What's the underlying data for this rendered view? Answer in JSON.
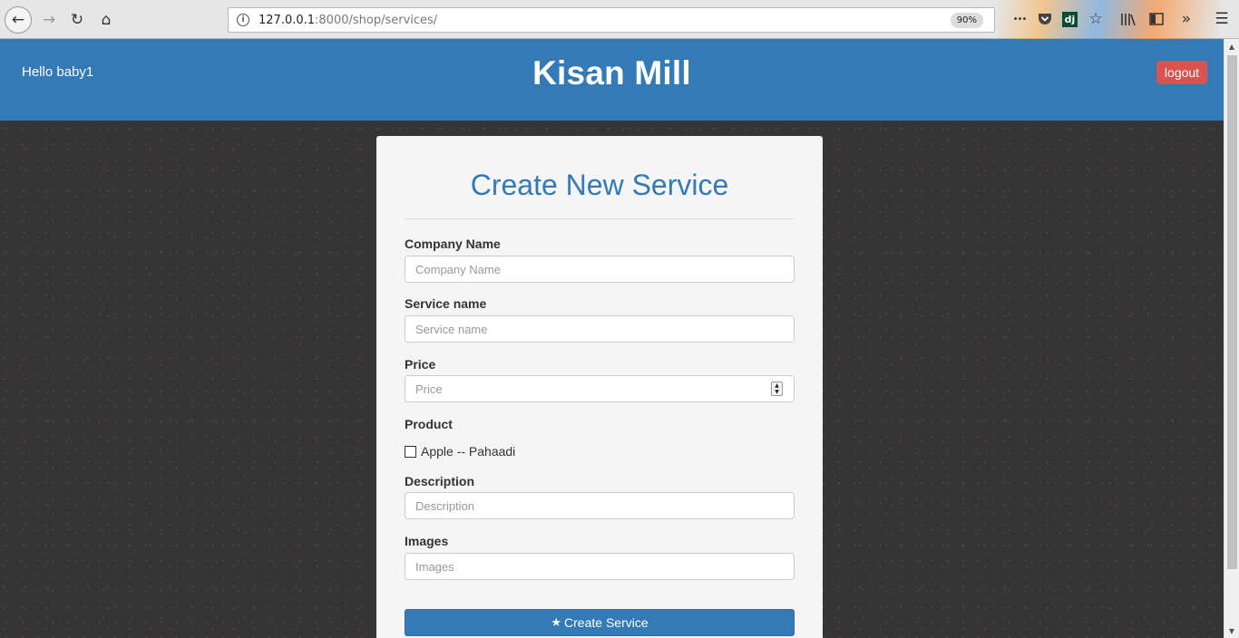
{
  "browser": {
    "url_host": "127.0.0.1",
    "url_rest": ":8000/shop/services/",
    "zoom": "90%",
    "extension_label": "dj",
    "menu_dots": "•••"
  },
  "header": {
    "greeting": "Hello baby1",
    "title": "Kisan Mill",
    "logout_label": "logout"
  },
  "form": {
    "title": "Create New Service",
    "company_name": {
      "label": "Company Name",
      "placeholder": "Company Name",
      "value": ""
    },
    "service_name": {
      "label": "Service name",
      "placeholder": "Service name",
      "value": ""
    },
    "price": {
      "label": "Price",
      "placeholder": "Price",
      "value": ""
    },
    "product": {
      "label": "Product",
      "options": [
        {
          "label": "Apple -- Pahaadi",
          "checked": false
        }
      ]
    },
    "description": {
      "label": "Description",
      "placeholder": "Description",
      "value": ""
    },
    "images": {
      "label": "Images",
      "placeholder": "Images",
      "value": ""
    },
    "submit_label": "Create Service"
  },
  "colors": {
    "header_bg": "#337ab7",
    "accent": "#337ab7",
    "danger": "#d9534f",
    "page_bg": "#353535"
  },
  "icons": {
    "back": "arrow-left-icon",
    "forward": "arrow-right-icon",
    "reload": "reload-icon",
    "home": "home-icon",
    "info": "info-icon",
    "submit": "star-icon"
  }
}
